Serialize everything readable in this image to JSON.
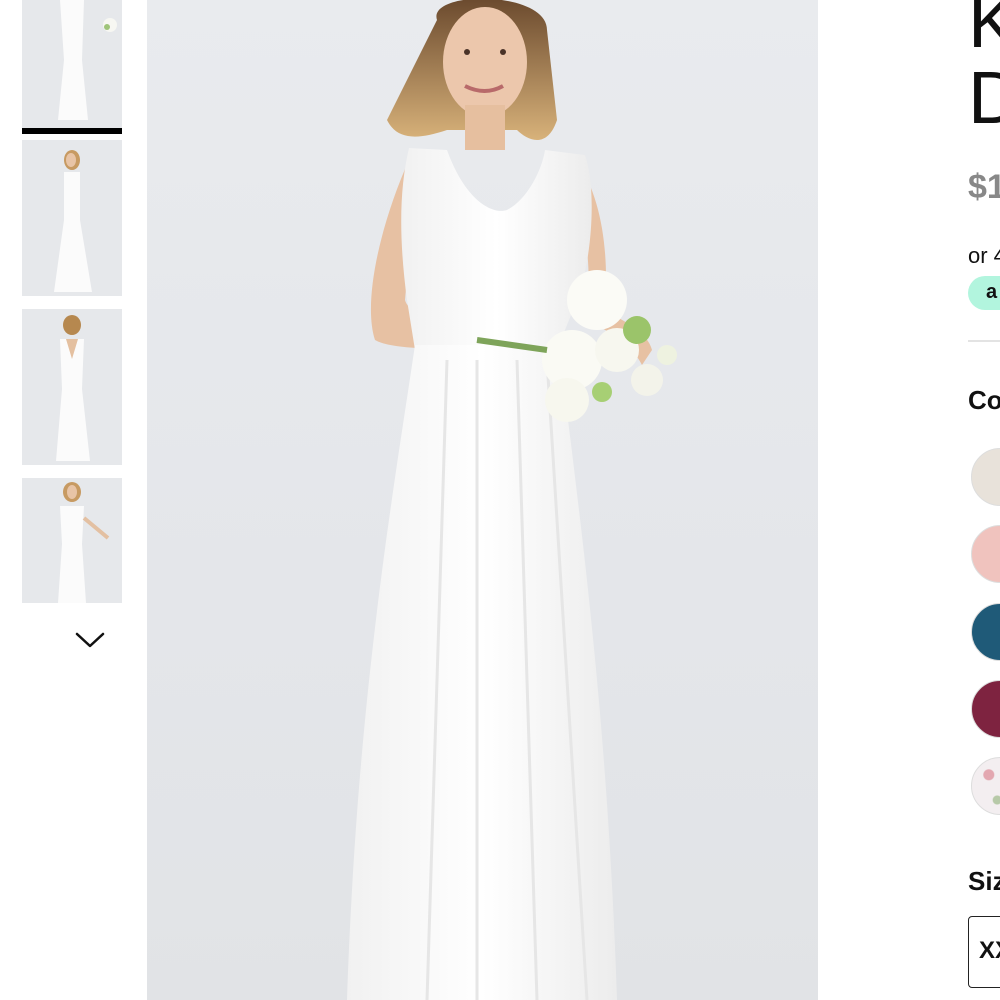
{
  "product": {
    "title": "K\nD",
    "price": "$1",
    "installment": "or 4"
  },
  "images": {
    "main_alt": "Woman in a white sleeveless maxi dress holding a white flower bouquet",
    "thumbnails": [
      {
        "view": "front holding bouquet",
        "active": true
      },
      {
        "view": "side",
        "active": false
      },
      {
        "view": "back",
        "active": false
      },
      {
        "view": "front full length",
        "active": false
      }
    ]
  },
  "payment": {
    "badge_text": "a",
    "badge_color": "#b2f5de"
  },
  "color_section": {
    "label": "Co",
    "swatches": [
      {
        "name": "champagne",
        "hex": "#e8e2da"
      },
      {
        "name": "blush",
        "hex": "#f0c3be"
      },
      {
        "name": "teal",
        "hex": "#1f5a78"
      },
      {
        "name": "burgundy",
        "hex": "#7e2340"
      },
      {
        "name": "floral print",
        "hex": "#f3eef0"
      }
    ]
  },
  "size_section": {
    "label": "Siz",
    "selected": "XX"
  },
  "icons": {
    "thumb_scroll": "chevron-down-icon"
  }
}
